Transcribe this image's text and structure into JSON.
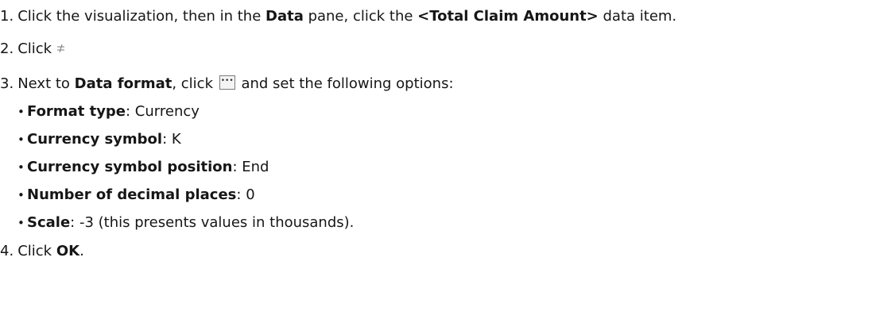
{
  "steps": [
    {
      "number": "1.",
      "text_a": "Click the visualization, then in the ",
      "bold_a": "Data",
      "text_b": " pane, click the ",
      "bold_b": "<Total Claim Amount>",
      "text_c": " data item."
    },
    {
      "number": "2.",
      "text_a": "Click ",
      "icon": "properties-toggle-icon"
    },
    {
      "number": "3.",
      "text_a": "Next to ",
      "bold_a": "Data format",
      "text_b": ", click ",
      "icon": "ellipsis-button-icon",
      "text_c": " and set the following options:"
    },
    {
      "number": "4.",
      "text_a": "Click ",
      "bold_a": "OK",
      "text_b": "."
    }
  ],
  "options": [
    {
      "bullet": "•",
      "label": "Format type",
      "value": ": Currency"
    },
    {
      "bullet": "•",
      "label": "Currency symbol",
      "value": ": K"
    },
    {
      "bullet": "•",
      "label": "Currency symbol position",
      "value": ": End"
    },
    {
      "bullet": "•",
      "label": "Number of decimal places",
      "value": ": 0"
    },
    {
      "bullet": "•",
      "label": "Scale",
      "value": ": -3 (this presents values in thousands)."
    }
  ]
}
